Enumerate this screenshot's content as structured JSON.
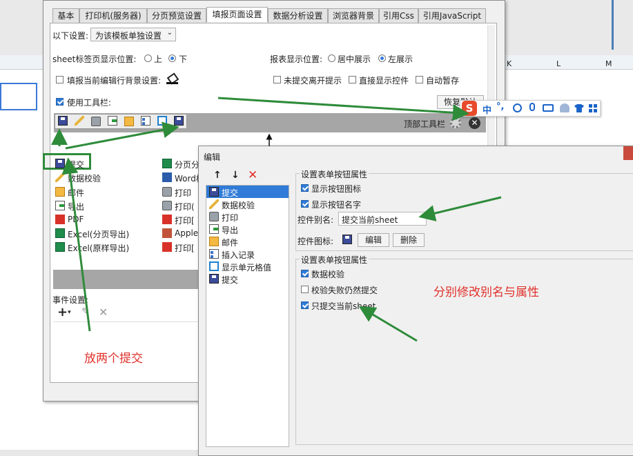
{
  "main_dialog": {
    "tabs": [
      "基本",
      "打印机(服务器)",
      "分页预览设置",
      "填报页面设置",
      "数据分析设置",
      "浏览器背景",
      "引用Css",
      "引用JavaScript"
    ],
    "settings_label": "以下设置:",
    "settings_value": "为该模板单独设置",
    "sheet_pos_label": "sheet标签页显示位置:",
    "sheet_pos_top": "上",
    "sheet_pos_bottom": "下",
    "report_pos_label": "报表显示位置:",
    "report_pos_center": "居中展示",
    "report_pos_left": "左展示",
    "fill_bg_label": "填报当前编辑行背景设置:",
    "unsubmitted_label": "未提交离开提示",
    "direct_show_label": "直接显示控件",
    "auto_save_label": "自动暂存",
    "use_toolbar_label": "使用工具栏:",
    "restore_default": "恢复默认",
    "top_toolbar_label": "顶部工具栏",
    "button_list_left": [
      "提交",
      "数据校验",
      "邮件",
      "导出",
      "PDF",
      "Excel(分页导出)",
      "Excel(原样导出)"
    ],
    "button_list_right": [
      "分页分",
      "Word格",
      "打印",
      "打印(",
      "打印[",
      "Applet",
      "打印["
    ],
    "events_label": "事件设置:",
    "annotation_two_submit": "放两个提交"
  },
  "edit_dialog": {
    "title": "编辑",
    "list_items": [
      "提交",
      "数据校验",
      "打印",
      "导出",
      "邮件",
      "插入记录",
      "显示单元格值",
      "提交"
    ],
    "form_props_title": "设置表单按钮属性",
    "show_icon_label": "显示按钮图标",
    "show_name_label": "显示按钮名字",
    "alias_label": "控件别名:",
    "alias_value": "提交当前sheet",
    "icon_label": "控件图标:",
    "edit_button": "编辑",
    "delete_button": "删除",
    "submit_props_title": "设置表单按钮属性",
    "validate_label": "数据校验",
    "fail_submit_label": "校验失败仍然提交",
    "only_sheet_label": "只提交当前sheet",
    "annotation_modify": "分别修改别名与属性"
  },
  "ime_bar": {
    "lang": "中",
    "punct": "°,"
  },
  "spreadsheet": {
    "cols": [
      "K",
      "L",
      "M"
    ]
  },
  "colors": {
    "accent": "#2f7bd7",
    "annotation_red": "#e0302a",
    "arrow_green": "#2e8b3a",
    "toolbar_gray": "#a6a6a6"
  }
}
